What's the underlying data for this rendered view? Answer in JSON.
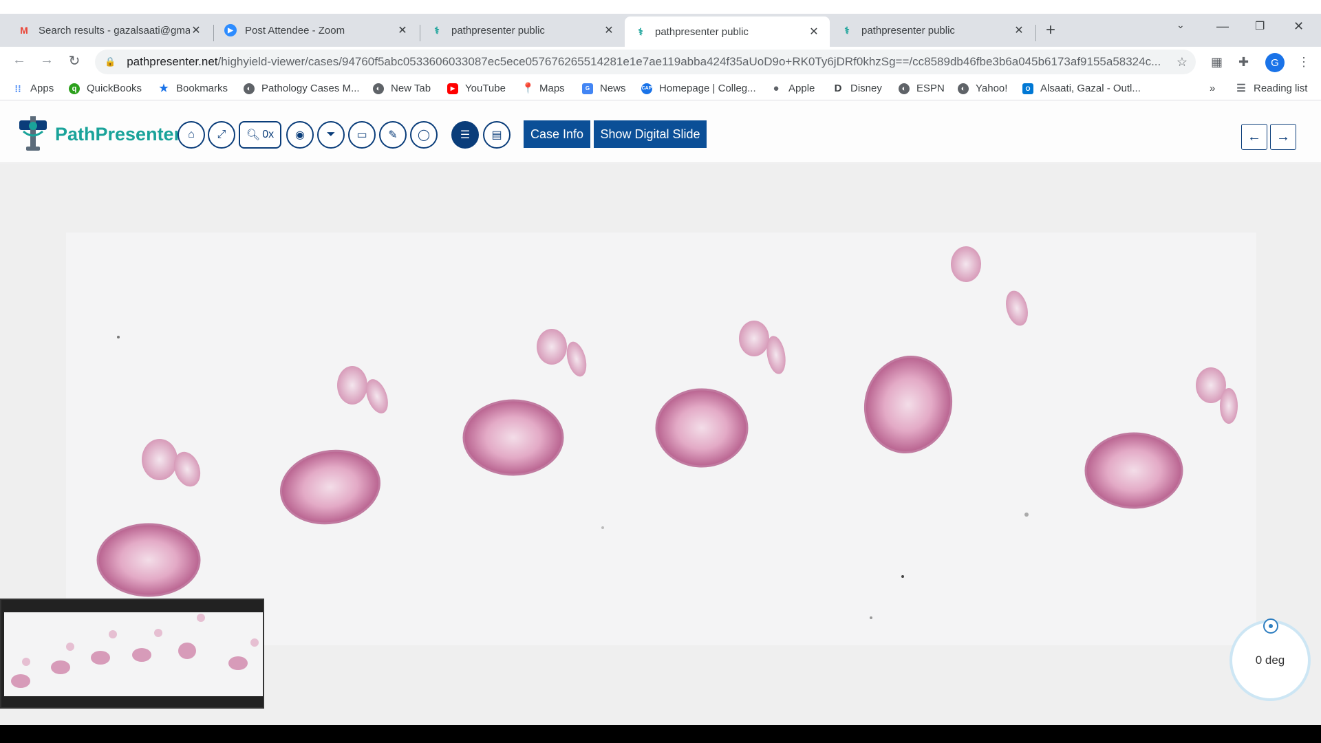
{
  "tabs": [
    {
      "title": "Search results - gazalsaati@gmail.com",
      "favicon": "gmail-icon",
      "active": false
    },
    {
      "title": "Post Attendee - Zoom",
      "favicon": "zoom-icon",
      "active": false
    },
    {
      "title": "pathpresenter public",
      "favicon": "pathpresenter-icon",
      "active": false
    },
    {
      "title": "pathpresenter public",
      "favicon": "pathpresenter-icon",
      "active": true
    },
    {
      "title": "pathpresenter public",
      "favicon": "pathpresenter-icon",
      "active": false
    }
  ],
  "address_bar": {
    "domain": "pathpresenter.net",
    "path": "/highyield-viewer/cases/94760f5abc0533606033087ec5ece057676265514281e1e7ae119abba424f35aUoD9o+RK0Ty6jDRf0khzSg==/cc8589db46fbe3b6a045b6173af9155a58324c..."
  },
  "bookmarks": {
    "items": [
      "Apps",
      "QuickBooks",
      "Bookmarks",
      "Pathology Cases M...",
      "New Tab",
      "YouTube",
      "Maps",
      "News",
      "Homepage | Colleg...",
      "Apple",
      "Disney",
      "ESPN",
      "Yahoo!",
      "Alsaati, Gazal - Outl..."
    ],
    "overflow": "»",
    "reading_list": "Reading list"
  },
  "profile_initial": "G",
  "app": {
    "brand": "PathPresenter",
    "brand_color": "#1aa39a",
    "accent_color": "#0b4f97",
    "zoom_label": "0x",
    "case_info_label": "Case Info",
    "show_slide_label": "Show Digital Slide"
  },
  "viewer": {
    "rotation_label": "0 deg"
  }
}
